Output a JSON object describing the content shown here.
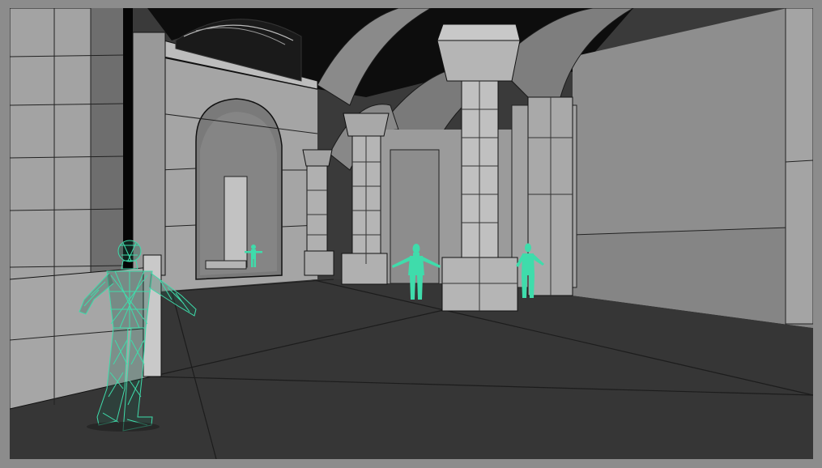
{
  "scene": {
    "colors": {
      "frame": "#8c8c8c",
      "floor": "#353535",
      "wall": "#9a9a9a",
      "wall_shade": "#7d7d7d",
      "wire": "#111111",
      "character": "#3fdcab",
      "character_wire": "#2bb88a",
      "ceiling_dark": "#0b0b0b"
    },
    "characters": [
      {
        "id": "wireframe-mannequin-front",
        "style": "wireframe",
        "pose": "t-pose"
      },
      {
        "id": "mannequin-center",
        "style": "solid",
        "pose": "t-pose"
      },
      {
        "id": "mannequin-right",
        "style": "solid",
        "pose": "t-pose"
      },
      {
        "id": "mannequin-far",
        "style": "solid",
        "pose": "t-pose"
      }
    ]
  }
}
